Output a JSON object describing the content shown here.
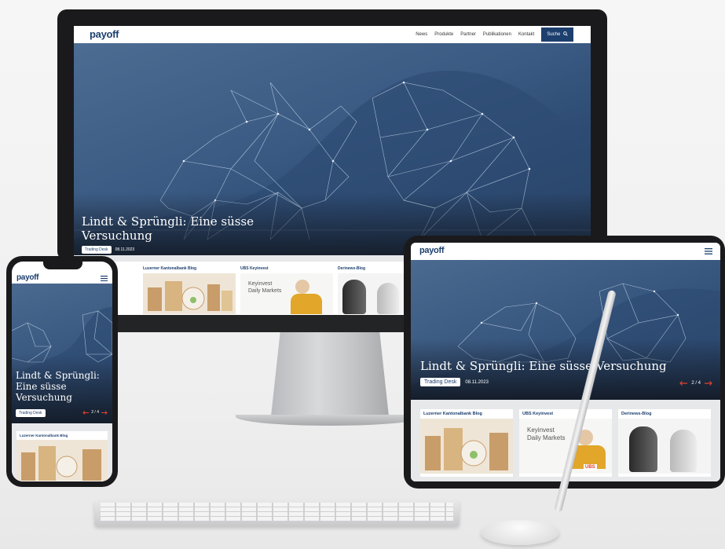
{
  "site": {
    "logo": "payoff",
    "nav": [
      "News",
      "Produkte",
      "Partner",
      "Publikationen",
      "Kontakt"
    ],
    "search_label": "Suche",
    "hero": {
      "title_desktop_line1": "Lindt & Sprüngli: Eine süsse",
      "title_desktop_line2": "Versuchung",
      "title_tablet": "Lindt & Sprüngli: Eine süsse Versuchung",
      "title_phone_line1": "Lindt & Sprüngli:",
      "title_phone_line2": "Eine süsse",
      "title_phone_line3": "Versuchung",
      "category": "Trading Desk",
      "date": "08.11.2023",
      "pager": "2 / 4"
    },
    "cards": [
      {
        "title": "Luzerner Kantonalbank Blog"
      },
      {
        "title": "UBS Keyinvest",
        "image_text_1": "Keyinvest",
        "image_text_2": "Daily Markets",
        "brand": "UBS"
      },
      {
        "title": "Derinews-Blog"
      }
    ]
  },
  "colors": {
    "brand": "#1c3f6e",
    "accent": "#e2422b",
    "hero": "#3a5a83"
  },
  "icons": [
    "search-icon",
    "menu-icon",
    "arrow-left-icon",
    "arrow-right-icon"
  ]
}
